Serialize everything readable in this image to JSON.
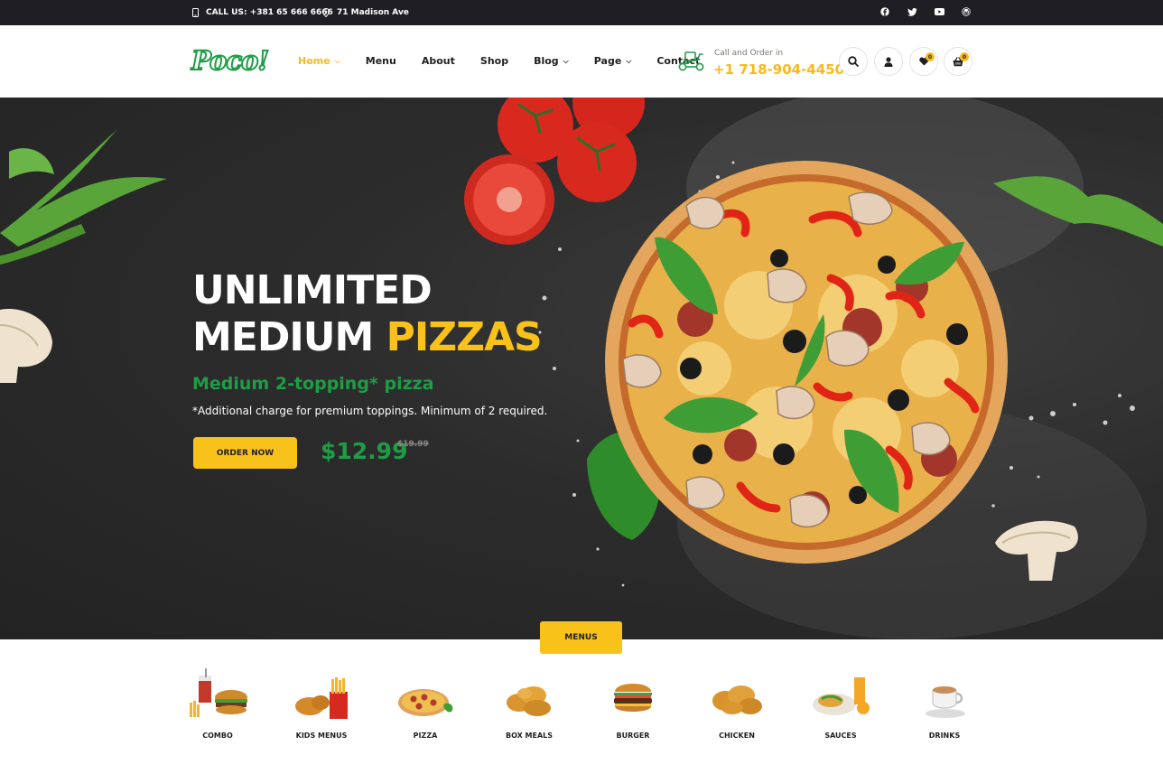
{
  "topbar": {
    "phone_label": "CALL US: +381 65 666 6666",
    "address": "71 Madison Ave",
    "socials": [
      "facebook-icon",
      "twitter-icon",
      "youtube-icon",
      "wordpress-icon"
    ]
  },
  "header": {
    "logo": "Poco!",
    "nav": [
      {
        "label": "Home",
        "dropdown": true,
        "active": true
      },
      {
        "label": "Menu",
        "dropdown": false
      },
      {
        "label": "About",
        "dropdown": false
      },
      {
        "label": "Shop",
        "dropdown": false
      },
      {
        "label": "Blog",
        "dropdown": true
      },
      {
        "label": "Page",
        "dropdown": true
      },
      {
        "label": "Contact",
        "dropdown": false
      }
    ],
    "call_label": "Call and Order in",
    "call_number": "+1 718-904-4450",
    "wishlist_count": "0",
    "cart_count": "0"
  },
  "hero": {
    "title_line1": "UNLIMITED",
    "title_line2_white": "MEDIUM",
    "title_line2_yellow": "PIZZAS",
    "subtitle": "Medium 2-topping* pizza",
    "note": "*Additional charge for premium toppings. Minimum of 2 required.",
    "cta": "ORDER NOW",
    "price": "$12.99",
    "old_price": "$19.99"
  },
  "menus_tab": "MENUS",
  "categories": [
    {
      "label": "COMBO"
    },
    {
      "label": "KIDS MENUS"
    },
    {
      "label": "PIZZA"
    },
    {
      "label": "BOX MEALS"
    },
    {
      "label": "BURGER"
    },
    {
      "label": "CHICKEN"
    },
    {
      "label": "SAUCES"
    },
    {
      "label": "DRINKS"
    }
  ],
  "colors": {
    "brand_green": "#1f9d46",
    "accent_yellow": "#f9c21b",
    "dark": "#1f1f23"
  }
}
